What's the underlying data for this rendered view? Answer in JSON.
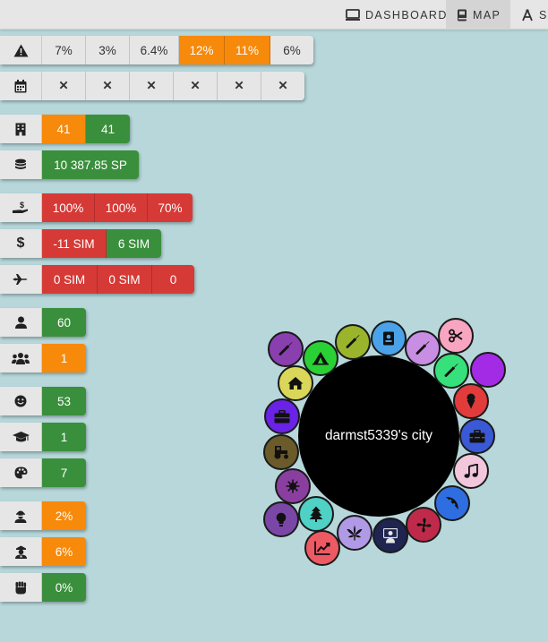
{
  "nav": {
    "dashboard_label": "DASHBOARD",
    "map_label": "MAP",
    "more_label": "SI"
  },
  "stats": {
    "risk": {
      "icon": "warning-icon",
      "values": [
        "7%",
        "3%",
        "6.4%",
        "12%",
        "11%",
        "6%"
      ],
      "colors": [
        "grey",
        "grey",
        "grey",
        "orange",
        "orange",
        "grey"
      ]
    },
    "calendar": {
      "icon": "calendar-icon",
      "values": [
        "✕",
        "✕",
        "✕",
        "✕",
        "✕",
        "✕"
      ]
    },
    "buildings": {
      "icon": "building-icon",
      "values": [
        "41",
        "41"
      ],
      "colors": [
        "orange",
        "green"
      ]
    },
    "money": {
      "icon": "coins-icon",
      "value": "10 387.85 SP"
    },
    "taxes": {
      "icon": "hand-dollar-icon",
      "values": [
        "100%",
        "100%",
        "70%"
      ]
    },
    "balance": {
      "icon": "dollar-icon",
      "values": [
        "-11 SIM",
        "6 SIM"
      ],
      "colors": [
        "red",
        "green"
      ]
    },
    "travel": {
      "icon": "plane-icon",
      "values": [
        "0 SIM",
        "0 SIM",
        "0"
      ]
    },
    "population": {
      "icon": "user-icon",
      "value": "60",
      "color": "green"
    },
    "groups": {
      "icon": "users-icon",
      "value": "1",
      "color": "orange"
    },
    "happiness": {
      "icon": "smile-icon",
      "value": "53",
      "color": "green"
    },
    "education": {
      "icon": "graduation-cap-icon",
      "value": "1",
      "color": "green"
    },
    "culture": {
      "icon": "palette-icon",
      "value": "7",
      "color": "green"
    },
    "crime": {
      "icon": "thief-icon",
      "value": "2%",
      "color": "orange"
    },
    "police": {
      "icon": "police-icon",
      "value": "6%",
      "color": "orange"
    },
    "protest": {
      "icon": "fist-icon",
      "value": "0%",
      "color": "green"
    }
  },
  "city": {
    "name": "darmst5339's city",
    "buildings": [
      {
        "icon": "wrench-icon",
        "color": "#8a3fae"
      },
      {
        "icon": "tent-icon",
        "color": "#2ad135"
      },
      {
        "icon": "wrench-icon",
        "color": "#9ab52c"
      },
      {
        "icon": "id-card-icon",
        "color": "#4aa3e8"
      },
      {
        "icon": "wrench-icon",
        "color": "#c88ee3"
      },
      {
        "icon": "scissors-icon",
        "color": "#f7a5c0"
      },
      {
        "icon": "wrench-icon",
        "color": "#36e07a"
      },
      {
        "icon": "empty",
        "color": "#a32be6"
      },
      {
        "icon": "home-icon",
        "color": "#d9d65a"
      },
      {
        "icon": "ice-cream-icon",
        "color": "#e23b3b"
      },
      {
        "icon": "briefcase-icon",
        "color": "#6a22e6"
      },
      {
        "icon": "toolbox-icon",
        "color": "#3a59d6"
      },
      {
        "icon": "tractor-icon",
        "color": "#6b5a2a"
      },
      {
        "icon": "music-icon",
        "color": "#f2c7dc"
      },
      {
        "icon": "virus-icon",
        "color": "#8a3fa0"
      },
      {
        "icon": "pizza-icon",
        "color": "#2f6ee0"
      },
      {
        "icon": "lightbulb-icon",
        "color": "#7a47a6"
      },
      {
        "icon": "tree-icon",
        "color": "#4fd1c5"
      },
      {
        "icon": "fan-icon",
        "color": "#c02a4a"
      },
      {
        "icon": "chart-icon",
        "color": "#ee5a63"
      },
      {
        "icon": "cannabis-icon",
        "color": "#b09ae6"
      },
      {
        "icon": "teacher-icon",
        "color": "#1f2550"
      }
    ]
  }
}
